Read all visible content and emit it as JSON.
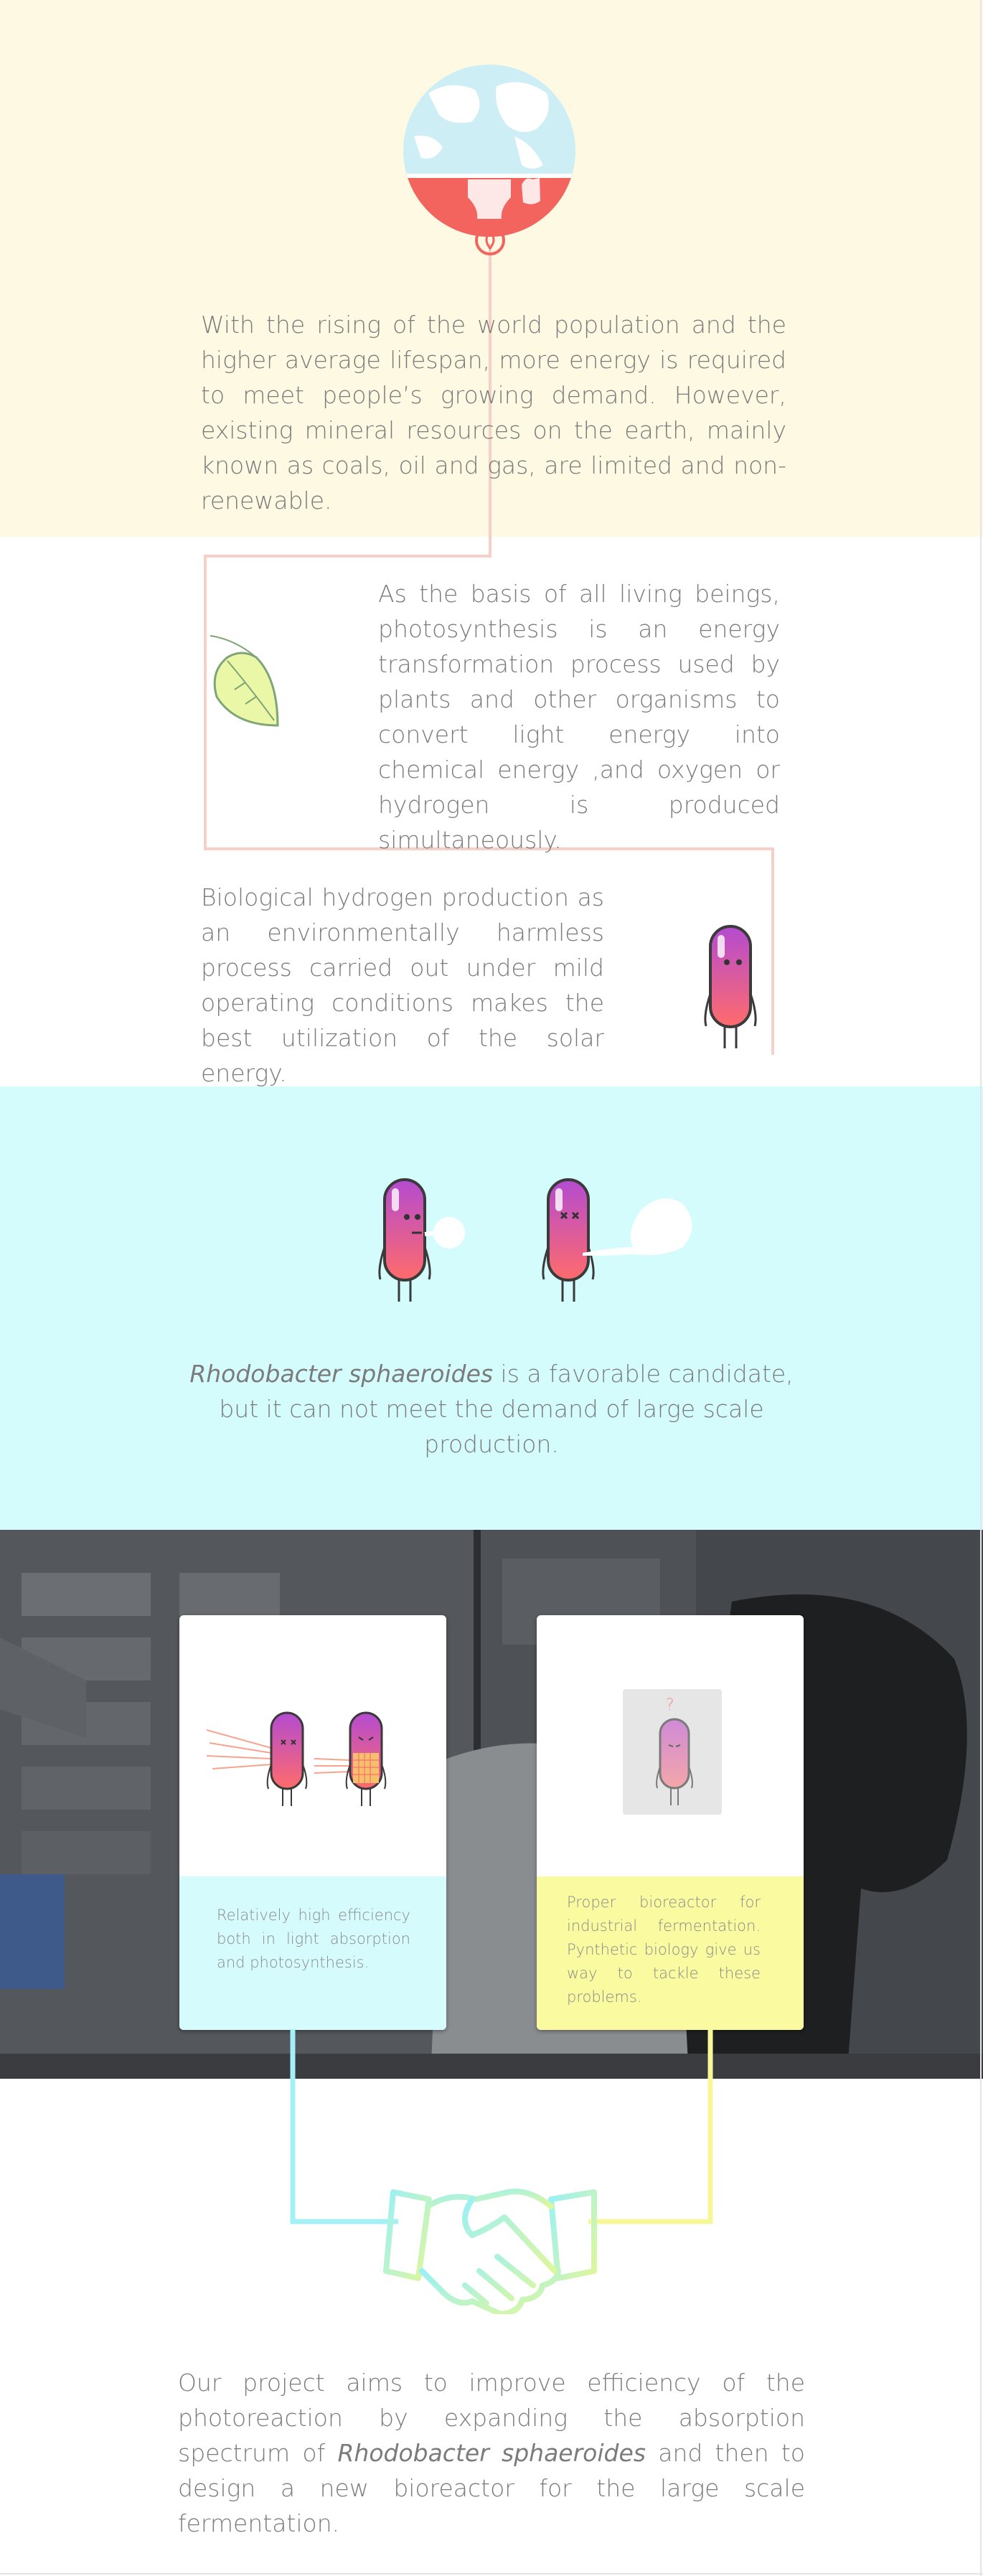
{
  "colors": {
    "top_background": "#fdf9e3",
    "cyan_background": "#d5fcfc",
    "earth_water": "#cdeef5",
    "earth_land": "#ffffff",
    "accent_red": "#f2645d",
    "leaf_fill": "#e9f7a6",
    "leaf_stroke": "#7fa577",
    "bacterium_top": "#b44bd1",
    "bacterium_bottom": "#ff6b6b",
    "card_left_bottom": "#d6fbfc",
    "card_right_bottom": "#fafaa0",
    "handshake": "#a6f2d0"
  },
  "icons": {
    "earth": "earth-resources-icon",
    "leaf": "leaf-icon",
    "bacterium": "bacterium-icon",
    "handshake": "handshake-icon"
  },
  "intro": {
    "text": "With the rising of the world population and the higher average lifespan, more energy is required to meet people’s growing demand. However, existing mineral resources on the earth, mainly known as coals, oil and gas, are limited and non-renewable."
  },
  "photosynthesis": {
    "text": "As the basis of all living beings, photosynthesis is an energy transformation process used by plants and other organisms to convert light energy  into chemical energy ,and oxygen or hydrogen is produced simultaneously."
  },
  "hydrogen": {
    "text": "Biological hydrogen production as an environmentally harmless process carried out under mild operating conditions makes the best utilization of the solar energy."
  },
  "candidate": {
    "species": "Rhodobacter sphaeroides",
    "text_rest": " is a favorable candidate, but it can not meet the demand of large scale production."
  },
  "cards": [
    {
      "text": "Relatively high efficiency both in light absorption and photosynthesis."
    },
    {
      "text": "Proper bioreactor for industrial fermentation. Pynthetic biology give us way to tackle these problems.",
      "question_mark": "?"
    }
  ],
  "project": {
    "text_before": "Our project aims to improve efficiency of the photoreaction by expanding the absorption spectrum of ",
    "species": "Rhodobacter sphaeroides",
    "text_after": " and then to design a new bioreactor for the large scale fermentation."
  }
}
